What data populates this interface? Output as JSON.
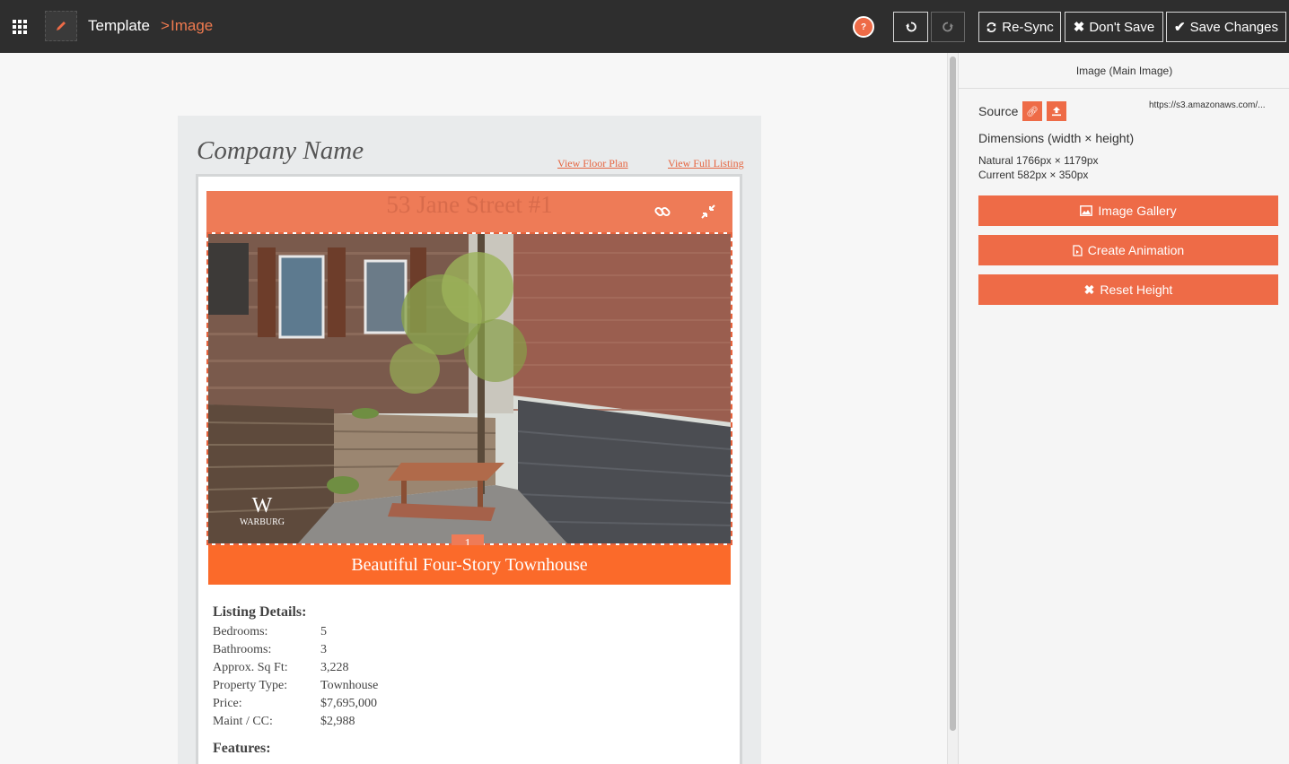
{
  "topbar": {
    "breadcrumb_root": "Template",
    "breadcrumb_separator": ">",
    "breadcrumb_current": "Image",
    "help_label": "?",
    "resync_label": "Re-Sync",
    "dont_save_label": "Don't Save",
    "save_label": "Save Changes",
    "icons": [
      "apps-grid-icon",
      "pencil-icon",
      "help-icon",
      "undo-icon",
      "redo-icon",
      "sync-icon",
      "close-icon",
      "check-icon"
    ]
  },
  "email": {
    "company_name": "Company Name",
    "link_floor_plan": "View Floor Plan",
    "link_full_listing": "View Full Listing",
    "address": "53 Jane Street #1",
    "image_tag": "1",
    "headline": "Beautiful Four-Story Townhouse",
    "photo_logo": "WARBURG",
    "details_title": "Listing Details:",
    "details": [
      {
        "label": "Bedrooms:",
        "value": "5"
      },
      {
        "label": "Bathrooms:",
        "value": "3"
      },
      {
        "label": "Approx. Sq Ft:",
        "value": "3,228"
      },
      {
        "label": "Property Type:",
        "value": "Townhouse"
      },
      {
        "label": "Price:",
        "value": "$7,695,000"
      },
      {
        "label": "Maint / CC:",
        "value": "$2,988"
      }
    ],
    "features_title": "Features:"
  },
  "panel": {
    "title": "Image (Main Image)",
    "source_label": "Source",
    "source_url": "https://s3.amazonaws.com/...",
    "dimensions_label": "Dimensions (width × height)",
    "natural": "Natural 1766px × 1179px",
    "current": "Current 582px × 350px",
    "gallery_label": "Image Gallery",
    "animation_label": "Create Animation",
    "reset_label": "Reset Height"
  },
  "colors": {
    "accent": "#ee6b47",
    "headline_bar": "#fb6a2a",
    "topbar": "#2e2e2e"
  }
}
